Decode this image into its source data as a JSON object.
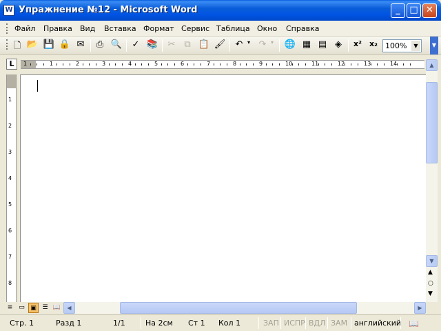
{
  "window": {
    "title": "Упражнение №12 - Microsoft Word",
    "app_icon": "word-doc-icon",
    "buttons": {
      "minimize": "_",
      "maximize": "□",
      "close": "✕"
    }
  },
  "menu": {
    "items": [
      "Файл",
      "Правка",
      "Вид",
      "Вставка",
      "Формат",
      "Сервис",
      "Таблица",
      "Окно",
      "Справка"
    ]
  },
  "toolbar": {
    "icons": [
      "new-document-icon",
      "open-folder-icon",
      "save-icon",
      "permission-icon",
      "email-icon",
      "print-icon",
      "print-preview-icon",
      "spelling-icon",
      "research-icon",
      "cut-icon",
      "copy-icon",
      "paste-icon",
      "format-painter-icon",
      "undo-icon",
      "redo-icon",
      "hyperlink-icon",
      "tables-borders-icon",
      "insert-table-icon",
      "drawing-icon",
      "superscript-icon",
      "subscript-icon"
    ],
    "zoom": "100%"
  },
  "ruler": {
    "corner": "L",
    "h_numbers": [
      "1",
      "1",
      "2",
      "3",
      "4",
      "5",
      "6",
      "7",
      "8",
      "9",
      "10",
      "11",
      "12",
      "13",
      "14"
    ],
    "v_numbers": [
      "1",
      "2",
      "3",
      "4",
      "5",
      "6",
      "7",
      "8"
    ]
  },
  "statusbar": {
    "page": "Стр. 1",
    "section": "Разд 1",
    "pages": "1/1",
    "position": "На 2см",
    "line": "Ст 1",
    "column": "Кол 1",
    "rec": "ЗАП",
    "trk": "ИСПР",
    "ext": "ВДЛ",
    "ovr": "ЗАМ",
    "language": "английский"
  }
}
